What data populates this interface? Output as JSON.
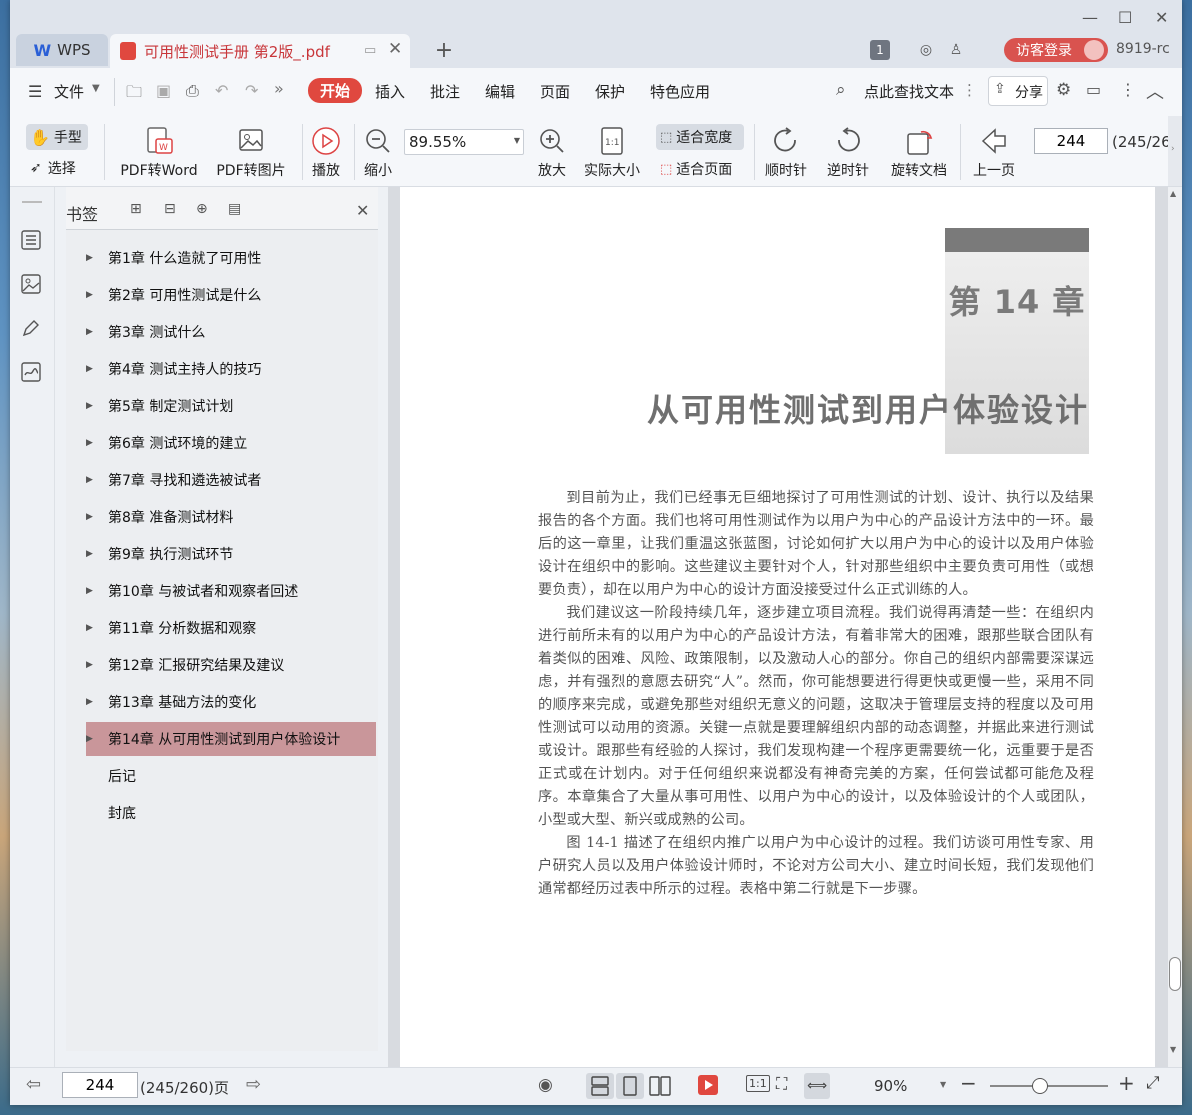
{
  "app": {
    "brand": "WPS",
    "doc_tab": "可用性测试手册 第2版_.pdf"
  },
  "titlebar": {
    "tab_count": "1",
    "login": "访客登录",
    "user_label": "8919-rc"
  },
  "menu": {
    "items": [
      "文件",
      "开始",
      "插入",
      "批注",
      "编辑",
      "页面",
      "保护",
      "特色应用"
    ],
    "search": "点此查找文本",
    "share": "分享"
  },
  "toolbar": {
    "hand": "手型",
    "select": "选择",
    "pdf_to_word": "PDF转Word",
    "pdf_to_image": "PDF转图片",
    "play": "播放",
    "zoom_out": "缩小",
    "zoom_value": "89.55%",
    "zoom_in": "放大",
    "actual_size": "实际大小",
    "fit_width": "适合宽度",
    "fit_page": "适合页面",
    "clockwise": "顺时针",
    "counterclockwise": "逆时针",
    "rotate_doc": "旋转文档",
    "prev_page": "上一页",
    "page_input": "244",
    "page_info": "(245/26"
  },
  "bookmarks": {
    "title": "书签",
    "items": [
      "第1章  什么造就了可用性",
      "第2章  可用性测试是什么",
      "第3章  测试什么",
      "第4章  测试主持人的技巧",
      "第5章  制定测试计划",
      "第6章  测试环境的建立",
      "第7章  寻找和遴选被试者",
      "第8章  准备测试材料",
      "第9章  执行测试环节",
      "第10章  与被试者和观察者回述",
      "第11章  分析数据和观察",
      "第12章  汇报研究结果及建议",
      "第13章  基础方法的变化",
      "第14章  从可用性测试到用户体验设计",
      "后记",
      "封底"
    ]
  },
  "page": {
    "chapter": "第 14 章",
    "title": "从可用性测试到用户体验设计",
    "paragraphs": [
      "到目前为止，我们已经事无巨细地探讨了可用性测试的计划、设计、执行以及结果报告的各个方面。我们也将可用性测试作为以用户为中心的产品设计方法中的一环。最后的这一章里，让我们重温这张蓝图，讨论如何扩大以用户为中心的设计以及用户体验设计在组织中的影响。这些建议主要针对个人，针对那些组织中主要负责可用性（或想要负责），却在以用户为中心的设计方面没接受过什么正式训练的人。",
      "我们建议这一阶段持续几年，逐步建立项目流程。我们说得再清楚一些：在组织内进行前所未有的以用户为中心的产品设计方法，有着非常大的困难，跟那些联合团队有着类似的困难、风险、政策限制，以及激动人心的部分。你自己的组织内部需要深谋远虑，并有强烈的意愿去研究“人”。然而，你可能想要进行得更快或更慢一些，采用不同的顺序来完成，或避免那些对组织无意义的问题，这取决于管理层支持的程度以及可用性测试可以动用的资源。关键一点就是要理解组织内部的动态调整，并据此来进行测试或设计。跟那些有经验的人探讨，我们发现构建一个程序更需要统一化，远重要于是否正式或在计划内。对于任何组织来说都没有神奇完美的方案，任何尝试都可能危及程序。本章集合了大量从事可用性、以用户为中心的设计，以及体验设计的个人或团队，小型或大型、新兴或成熟的公司。",
      "图 14-1 描述了在组织内推广以用户为中心设计的过程。我们访谈可用性专家、用户研究人员以及用户体验设计师时，不论对方公司大小、建立时间长短，我们发现他们通常都经历过表中所示的过程。表格中第二行就是下一步骤。"
    ]
  },
  "status": {
    "page_input": "244",
    "page_info": "(245/260)页",
    "zoom": "90%"
  }
}
